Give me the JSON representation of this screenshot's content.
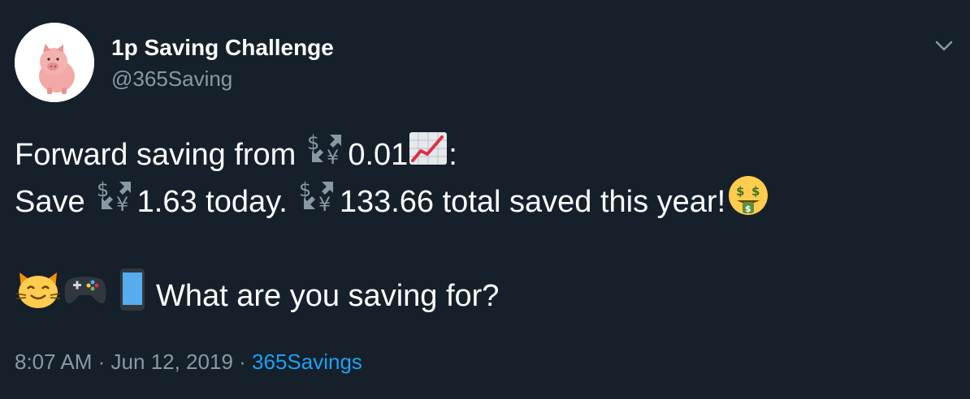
{
  "author": {
    "name": "1p Saving Challenge",
    "handle": "@365Saving",
    "avatar_icon": "piggy-bank-icon"
  },
  "menu_icon": "chevron-down-icon",
  "tweet": {
    "line1_text": "Forward saving from",
    "line1_amount": "0.01",
    "line1_end": ":",
    "line2_save": "Save",
    "line2_today": "1.63 today.",
    "line2_total": "133.66 total saved this year!",
    "line4_text": "What are you saving for?",
    "emoji": {
      "currency_exchange": "currency-exchange-icon",
      "chart": "chart-increasing-icon",
      "money_face": "money-mouth-face-icon",
      "cat": "smiling-cat-icon",
      "gamepad": "video-game-icon",
      "phone": "mobile-phone-icon"
    }
  },
  "meta": {
    "time": "8:07 AM",
    "separator": "·",
    "date": "Jun 12, 2019",
    "source": "365Savings"
  },
  "colors": {
    "background": "#15202b",
    "secondary_text": "#8899a6",
    "link": "#1da1f2"
  }
}
